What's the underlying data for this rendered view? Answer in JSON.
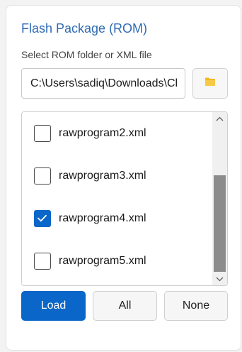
{
  "panel": {
    "title": "Flash Package (ROM)",
    "subtitle": "Select ROM folder or XML file",
    "path_value": "C:\\Users\\sadiq\\Downloads\\Cl",
    "browse_icon": "folder-icon"
  },
  "file_list": {
    "items": [
      {
        "label": "rawprogram2.xml",
        "checked": false
      },
      {
        "label": "rawprogram3.xml",
        "checked": false
      },
      {
        "label": "rawprogram4.xml",
        "checked": true
      },
      {
        "label": "rawprogram5.xml",
        "checked": false
      }
    ]
  },
  "buttons": {
    "load": "Load",
    "all": "All",
    "none": "None"
  },
  "colors": {
    "accent": "#0a66c8",
    "title": "#2f6bb3",
    "folder": "#f2b81c"
  }
}
